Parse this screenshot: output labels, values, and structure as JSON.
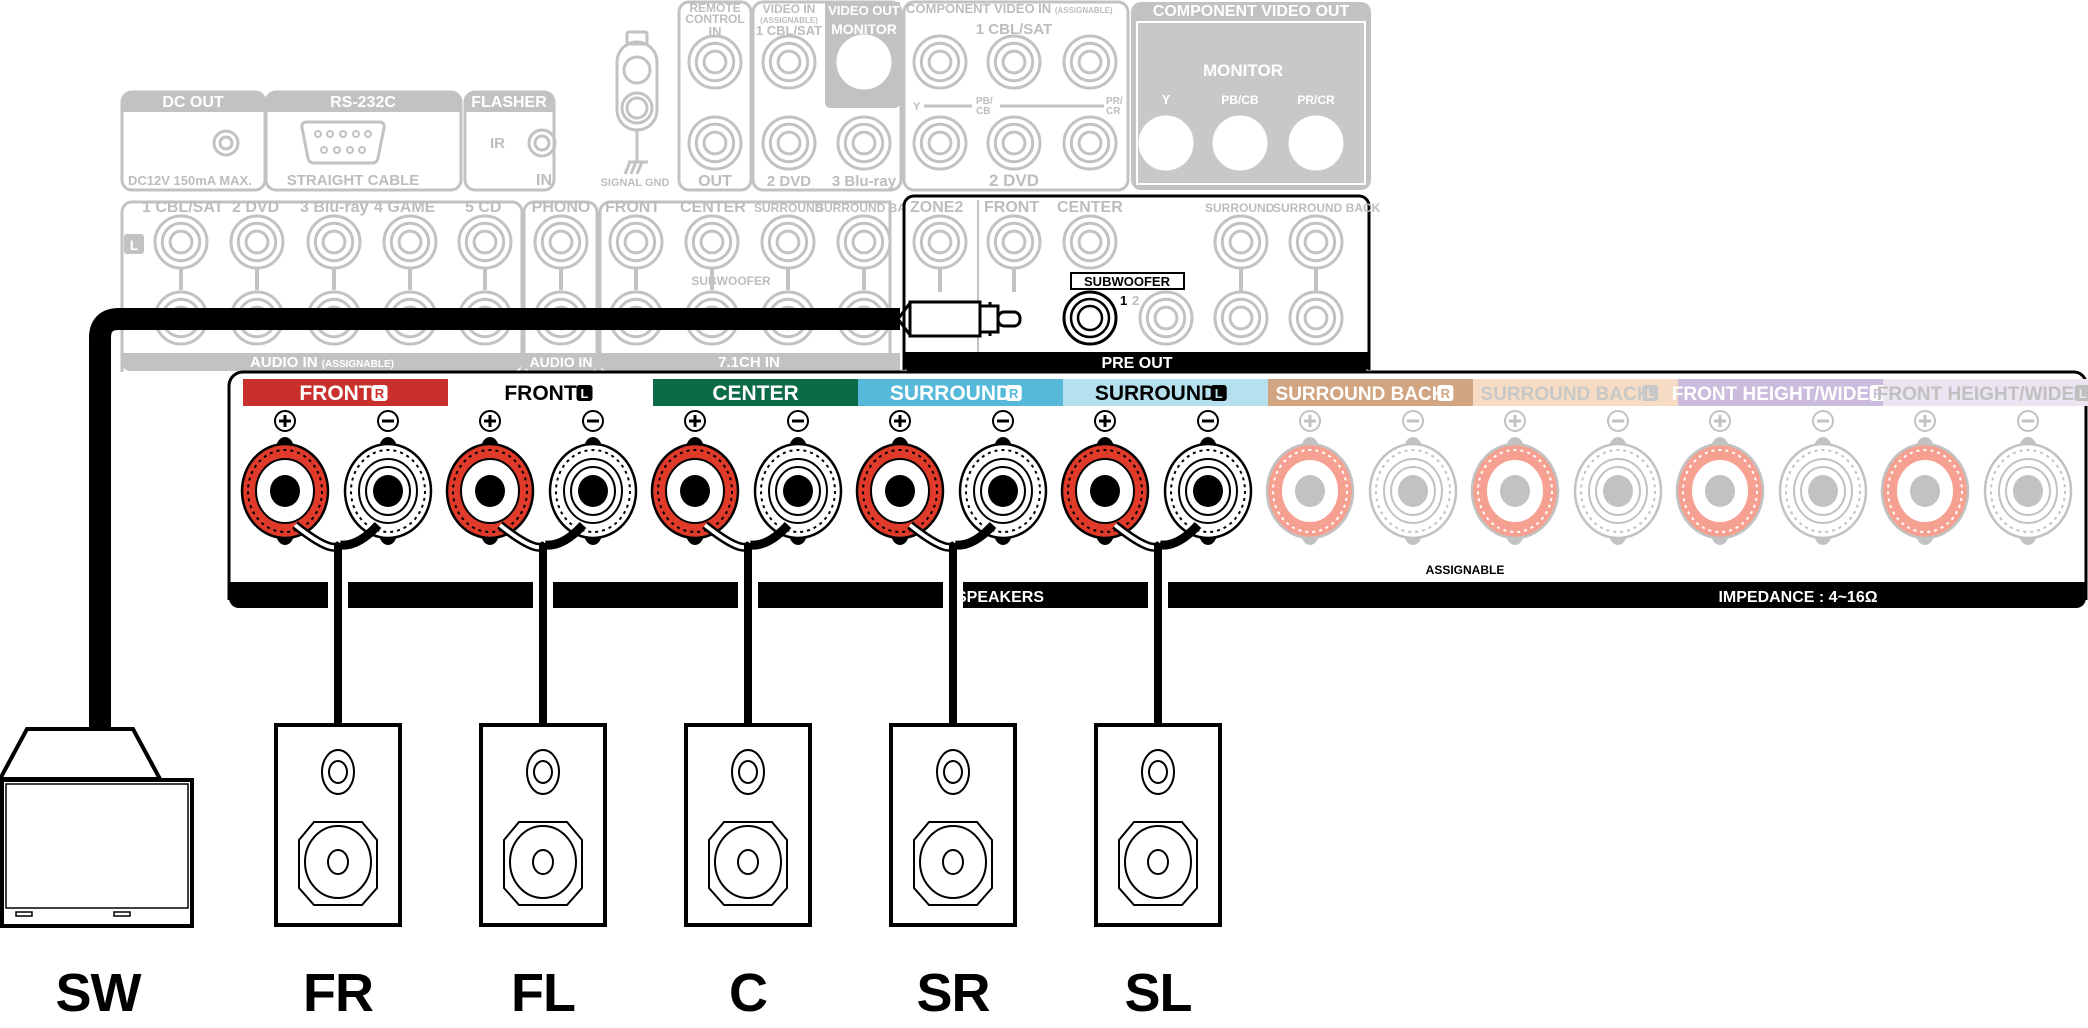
{
  "rear_panel": {
    "dc_out": {
      "title": "DC OUT",
      "note": "DC12V 150mA MAX."
    },
    "rs232c": {
      "title": "RS-232C",
      "note": "STRAIGHT CABLE"
    },
    "flasher": {
      "title": "FLASHER",
      "ir": "IR",
      "in": "IN"
    },
    "signal_gnd": "SIGNAL GND",
    "remote_control": {
      "title_1": "REMOTE",
      "title_2": "CONTROL",
      "in": "IN",
      "out": "OUT"
    },
    "video_in": {
      "title": "VIDEO IN",
      "sub": "(ASSIGNABLE)",
      "inputs": [
        "1 CBL/SAT",
        "2 DVD",
        "3 Blu-ray"
      ]
    },
    "video_out": {
      "title": "VIDEO OUT",
      "monitor": "MONITOR"
    },
    "component_video_in": {
      "title": "COMPONENT VIDEO IN",
      "sub": "(ASSIGNABLE)",
      "top": "1 CBL/SAT",
      "bottom": "2 DVD",
      "y": "Y",
      "pb": "PB/",
      "cb": "CB",
      "pr": "PR/",
      "cr": "CR"
    },
    "component_video_out": {
      "title": "COMPONENT VIDEO OUT",
      "monitor": "MONITOR",
      "y": "Y",
      "pbcb": "PB/CB",
      "prcr": "PR/CR"
    },
    "audio_in": {
      "inputs": [
        "1 CBL/SAT",
        "2 DVD",
        "3 Blu-ray",
        "4 GAME",
        "5 CD"
      ],
      "left_badge": "L",
      "footer": "AUDIO IN",
      "footer_sub": "(ASSIGNABLE)"
    },
    "phono": {
      "title": "PHONO",
      "footer": "AUDIO IN"
    },
    "ch71_in": {
      "labels": [
        "FRONT",
        "CENTER",
        "SURROUND",
        "SURROUND BACK"
      ],
      "sub": "SUBWOOFER",
      "footer": "7.1CH IN"
    },
    "pre_out": {
      "labels": [
        "ZONE2",
        "FRONT",
        "CENTER",
        "SURROUND",
        "SURROUND BACK"
      ],
      "subwoofer": "SUBWOOFER",
      "sw1": "1",
      "sw2": "2",
      "footer": "PRE OUT"
    }
  },
  "speaker_terminals": {
    "groups": [
      {
        "label": "FRONT",
        "side": "R",
        "bg": "#c9302c",
        "fg": "#ffffff",
        "active": true
      },
      {
        "label": "FRONT",
        "side": "L",
        "bg": "#ffffff",
        "fg": "#000000",
        "active": true
      },
      {
        "label": "CENTER",
        "side": "",
        "bg": "#0b6b46",
        "fg": "#ffffff",
        "active": true
      },
      {
        "label": "SURROUND",
        "side": "R",
        "bg": "#56b9d9",
        "fg": "#ffffff",
        "active": true
      },
      {
        "label": "SURROUND",
        "side": "L",
        "bg": "#b6e0ee",
        "fg": "#000000",
        "active": true
      },
      {
        "label": "SURROUND BACK",
        "side": "R",
        "bg": "#d2a582",
        "fg": "#ffffff",
        "active": false
      },
      {
        "label": "SURROUND BACK",
        "side": "L",
        "bg": "#f6dcc4",
        "fg": "#c8c8c8",
        "active": false
      },
      {
        "label": "FRONT HEIGHT/WIDE",
        "side": "R",
        "bg": "#cbbbdc",
        "fg": "#ffffff",
        "active": false
      },
      {
        "label": "FRONT HEIGHT/WIDE",
        "side": "L",
        "bg": "#ebe4f1",
        "fg": "#c0c0c0",
        "active": false
      }
    ],
    "plus": "+",
    "minus": "−",
    "assignable": "ASSIGNABLE",
    "footer_speakers": "SPEAKERS",
    "impedance": "IMPEDANCE : 4~16Ω"
  },
  "speakers": [
    {
      "id": "SW",
      "label": "SW",
      "type": "subwoofer"
    },
    {
      "id": "FR",
      "label": "FR",
      "type": "bookshelf"
    },
    {
      "id": "FL",
      "label": "FL",
      "type": "bookshelf"
    },
    {
      "id": "C",
      "label": "C",
      "type": "bookshelf"
    },
    {
      "id": "SR",
      "label": "SR",
      "type": "bookshelf"
    },
    {
      "id": "SL",
      "label": "SL",
      "type": "bookshelf"
    }
  ],
  "colors": {
    "red_terminal": "#e03a2a",
    "faded_red": "#f5a090",
    "grey": "#c2c2c2",
    "black": "#000000"
  }
}
